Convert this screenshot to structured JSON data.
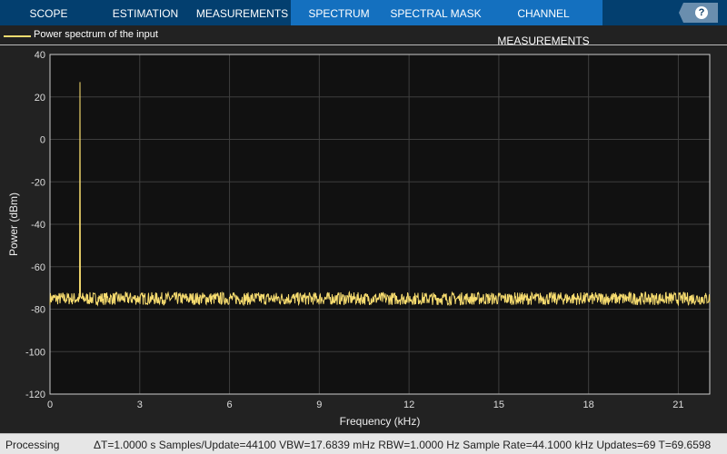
{
  "tabs": [
    {
      "label": "SCOPE",
      "active": false
    },
    {
      "label": "ESTIMATION",
      "active": false
    },
    {
      "label": "MEASUREMENTS",
      "active": false
    },
    {
      "label": "SPECTRUM",
      "active": true
    },
    {
      "label": "SPECTRAL MASK",
      "active": true
    },
    {
      "label": "CHANNEL MEASUREMENTS",
      "active": true
    }
  ],
  "help_icon": "?",
  "status": {
    "state": "Processing",
    "info": "ΔT=1.0000 s  Samples/Update=44100  VBW=17.6839 mHz  RBW=1.0000 Hz  Sample Rate=44.1000 kHz  Updates=69  T=69.6598"
  },
  "chart_data": {
    "type": "line",
    "title": "",
    "xlabel": "Frequency (kHz)",
    "ylabel": "Power (dBm)",
    "xlim": [
      0,
      22.05
    ],
    "ylim": [
      -120,
      40
    ],
    "xticks": [
      0,
      3,
      6,
      9,
      12,
      15,
      18,
      21
    ],
    "yticks": [
      40,
      20,
      0,
      -20,
      -40,
      -60,
      -80,
      -100,
      -120
    ],
    "grid": true,
    "legend": {
      "placement": "top-left",
      "entries": [
        "Power spectrum of the input"
      ]
    },
    "series": [
      {
        "name": "Power spectrum of the input",
        "color": "#f7dc6f",
        "tone_freq_khz": 1.0,
        "tone_peak_dbm": 27,
        "noise_floor_dbm": -75,
        "noise_spread_db": 3
      }
    ]
  }
}
